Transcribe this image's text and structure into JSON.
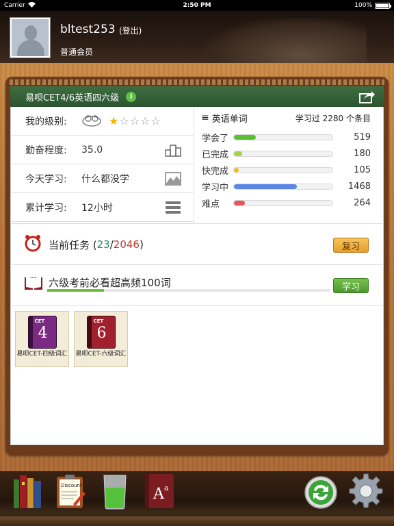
{
  "status_bar": {
    "carrier": "Carrier",
    "time": "2:50 PM",
    "battery": "100%"
  },
  "header": {
    "username": "bltest253",
    "logout_label": "(登出)",
    "member_level": "普通会员"
  },
  "course": {
    "title": "易呗CET4/6英语四六级",
    "info_icon_glyph": "i"
  },
  "stats_left": {
    "level_label": "我的级别:",
    "level_stars": 1,
    "level_stars_max": 5,
    "diligence_label": "勤奋程度:",
    "diligence_value": "35.0",
    "today_label": "今天学习:",
    "today_value": "什么都没学",
    "total_label": "累计学习:",
    "total_value": "12小时"
  },
  "stats_right": {
    "title": "英语单词",
    "summary": "学习过 2280 个条目",
    "rows": [
      {
        "label": "学会了",
        "value": "519",
        "fraction": 0.22,
        "color": "#5bbf34"
      },
      {
        "label": "已完成",
        "value": "180",
        "fraction": 0.08,
        "color": "#9fd646"
      },
      {
        "label": "快完成",
        "value": "105",
        "fraction": 0.05,
        "color": "#f2b833"
      },
      {
        "label": "学习中",
        "value": "1468",
        "fraction": 0.64,
        "color": "#5b86e5"
      },
      {
        "label": "难点",
        "value": "264",
        "fraction": 0.11,
        "color": "#e8555a"
      }
    ]
  },
  "task": {
    "label": "当前任务 (",
    "done": "23",
    "sep": "/",
    "total": "2046",
    "close": ")",
    "review_button": "复习"
  },
  "plan": {
    "label": "六级考前必看超高频100词",
    "progress": 0.2,
    "study_button": "学习"
  },
  "books": [
    {
      "badge": "CET",
      "number": "4",
      "caption": "易呗CET-四级词汇"
    },
    {
      "badge": "CET",
      "number": "6",
      "caption": "易呗CET-六级词汇"
    }
  ],
  "dock": {
    "items": [
      "bookshelf-icon",
      "clipboard-icon",
      "beaker-icon",
      "dictionary-icon",
      "sync-icon",
      "settings-icon"
    ],
    "clipboard_label": "Discount",
    "dictionary_glyph": "A",
    "dictionary_superscript": "a"
  },
  "colors": {
    "title_bar": "#2f5b33",
    "wood": "#b8753a",
    "review_button": "#f0b445",
    "study_button": "#5fae39"
  }
}
